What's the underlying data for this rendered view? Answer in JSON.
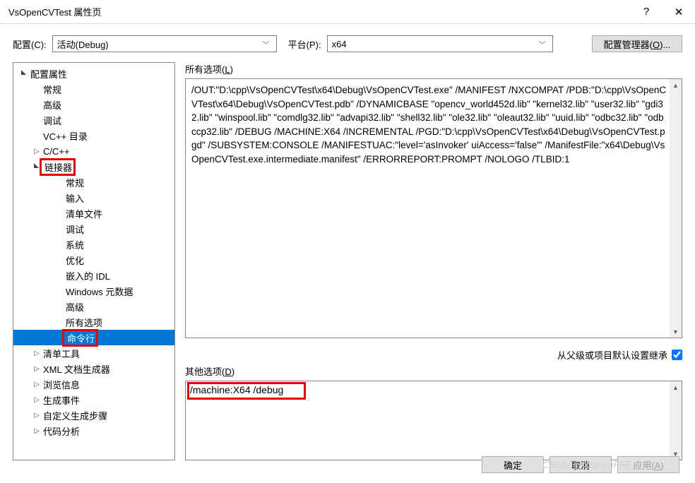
{
  "window": {
    "title": "VsOpenCVTest 属性页",
    "help": "?",
    "close": "✕"
  },
  "header": {
    "config_label": "配置(C):",
    "config_value": "活动(Debug)",
    "platform_label": "平台(P):",
    "platform_value": "x64",
    "manager_btn": "配置管理器(O)..."
  },
  "tree": [
    {
      "l": "配置属性",
      "depth": 0,
      "exp": "▢◣"
    },
    {
      "l": "常规",
      "depth": 1
    },
    {
      "l": "高级",
      "depth": 1
    },
    {
      "l": "调试",
      "depth": 1
    },
    {
      "l": "VC++ 目录",
      "depth": 1
    },
    {
      "l": "C/C++",
      "depth": 1,
      "exp": "▷"
    },
    {
      "l": "链接器",
      "depth": 1,
      "exp": "▢◣",
      "red": true
    },
    {
      "l": "常规",
      "depth": 2
    },
    {
      "l": "输入",
      "depth": 2
    },
    {
      "l": "清单文件",
      "depth": 2
    },
    {
      "l": "调试",
      "depth": 2
    },
    {
      "l": "系统",
      "depth": 2
    },
    {
      "l": "优化",
      "depth": 2
    },
    {
      "l": "嵌入的 IDL",
      "depth": 2
    },
    {
      "l": "Windows 元数据",
      "depth": 2
    },
    {
      "l": "高级",
      "depth": 2
    },
    {
      "l": "所有选项",
      "depth": 2
    },
    {
      "l": "命令行",
      "depth": 2,
      "sel": true,
      "red": true
    },
    {
      "l": "清单工具",
      "depth": 1,
      "exp": "▷"
    },
    {
      "l": "XML 文档生成器",
      "depth": 1,
      "exp": "▷"
    },
    {
      "l": "浏览信息",
      "depth": 1,
      "exp": "▷"
    },
    {
      "l": "生成事件",
      "depth": 1,
      "exp": "▷"
    },
    {
      "l": "自定义生成步骤",
      "depth": 1,
      "exp": "▷"
    },
    {
      "l": "代码分析",
      "depth": 1,
      "exp": "▷"
    }
  ],
  "all_options": {
    "label": "所有选项(L)",
    "text": "/OUT:\"D:\\cpp\\VsOpenCVTest\\x64\\Debug\\VsOpenCVTest.exe\" /MANIFEST /NXCOMPAT /PDB:\"D:\\cpp\\VsOpenCVTest\\x64\\Debug\\VsOpenCVTest.pdb\" /DYNAMICBASE \"opencv_world452d.lib\" \"kernel32.lib\" \"user32.lib\" \"gdi32.lib\" \"winspool.lib\" \"comdlg32.lib\" \"advapi32.lib\" \"shell32.lib\" \"ole32.lib\" \"oleaut32.lib\" \"uuid.lib\" \"odbc32.lib\" \"odbccp32.lib\" /DEBUG /MACHINE:X64 /INCREMENTAL /PGD:\"D:\\cpp\\VsOpenCVTest\\x64\\Debug\\VsOpenCVTest.pgd\" /SUBSYSTEM:CONSOLE /MANIFESTUAC:\"level='asInvoker' uiAccess='false'\" /ManifestFile:\"x64\\Debug\\VsOpenCVTest.exe.intermediate.manifest\" /ERRORREPORT:PROMPT /NOLOGO /TLBID:1"
  },
  "inherit": {
    "label": "从父级或项目默认设置继承",
    "checked": true
  },
  "other_options": {
    "label": "其他选项(D)",
    "text": "/machine:X64 /debug"
  },
  "buttons": {
    "ok": "确定",
    "cancel": "取消",
    "apply": "应用(A)"
  },
  "watermark": "CSDN @XianyuFFF"
}
